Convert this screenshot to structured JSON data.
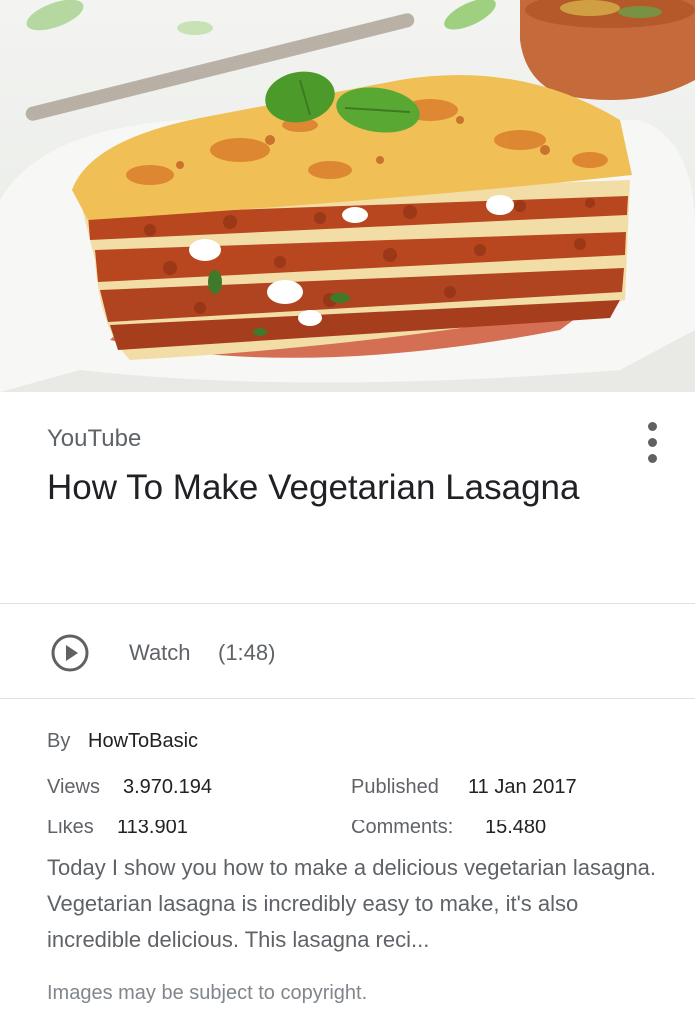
{
  "hero": {
    "alt": "lasagna-photo"
  },
  "card": {
    "source": "YouTube",
    "title": "How To Make Vegetarian Lasagna",
    "watch_label": "Watch",
    "watch_duration": "(1:48)",
    "by_label": "By",
    "channel": "HowToBasic",
    "views_label": "Views",
    "views_value": "3.970.194",
    "published_label": "Published",
    "published_value": "11 Jan 2017",
    "likes_label": "Likes",
    "likes_value": "113.901",
    "comments_label": "Comments:",
    "comments_value": "15.480",
    "description": "Today I show you how to make a delicious vegetarian lasagna. Vegetarian lasagna is incredibly easy to make, it's also incredible delicious. This lasagna reci...",
    "copyright": "Images may be subject to copyright."
  },
  "icons": {
    "more": "more-vert-icon",
    "play": "play-circle-icon"
  },
  "colors": {
    "text_primary": "#202124",
    "text_secondary": "#5f6368",
    "icon": "#616161"
  }
}
